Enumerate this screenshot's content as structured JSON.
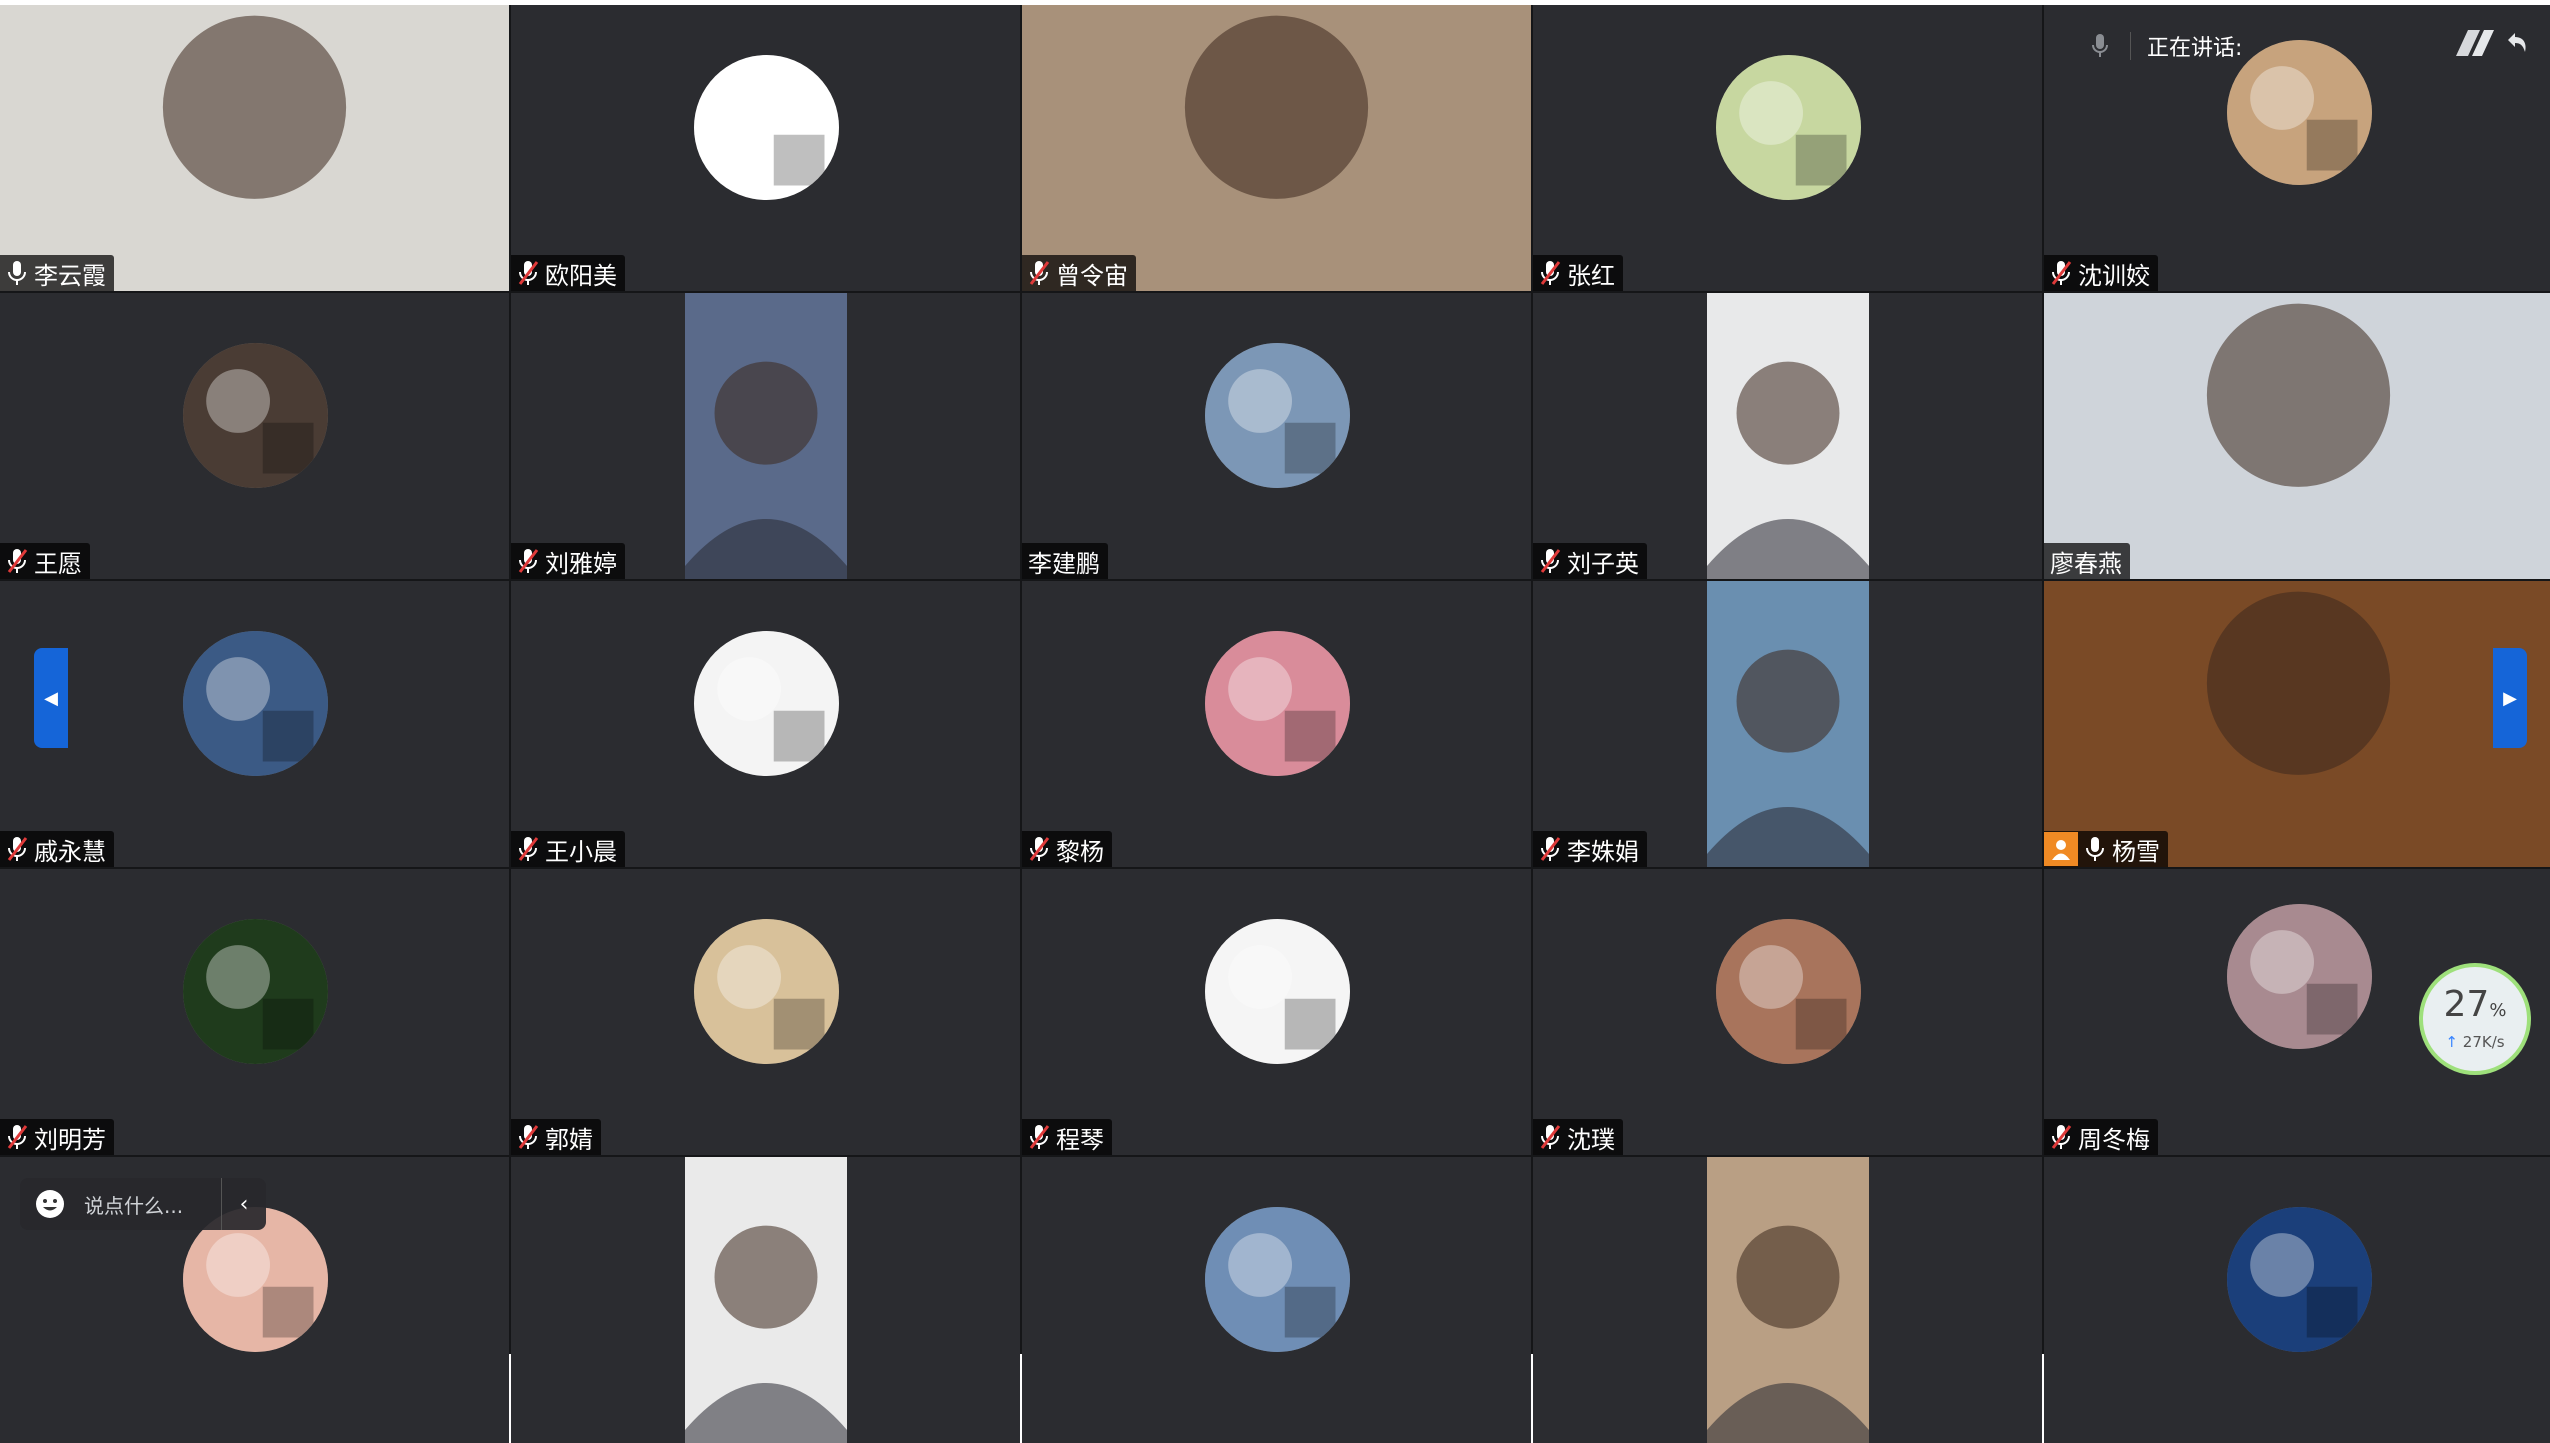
{
  "speaking_bar": {
    "label": "正在讲话:"
  },
  "chat": {
    "placeholder": "说点什么..."
  },
  "network": {
    "percent": "27",
    "percent_unit": "%",
    "speed": "27K/s"
  },
  "participants": [
    {
      "name": "李云霞",
      "mic": "on",
      "media": "video-full",
      "color": "#d9d7d2"
    },
    {
      "name": "欧阳美",
      "mic": "off",
      "media": "avatar",
      "color": "#ffffff"
    },
    {
      "name": "曾令宙",
      "mic": "off",
      "media": "video-full",
      "color": "#a8917a"
    },
    {
      "name": "张红",
      "mic": "off",
      "media": "avatar",
      "color": "#c7d7a0"
    },
    {
      "name": "沈训姣",
      "mic": "off",
      "media": "avatar-small",
      "color": "#c7a37d"
    },
    {
      "name": "王愿",
      "mic": "off",
      "media": "avatar",
      "color": "#4a3c34"
    },
    {
      "name": "刘雅婷",
      "mic": "off",
      "media": "video-portrait",
      "color": "#5a6a8a"
    },
    {
      "name": "李建鹏",
      "mic": "none",
      "media": "avatar",
      "color": "#7c97b6"
    },
    {
      "name": "刘子英",
      "mic": "off",
      "media": "video-portrait",
      "color": "#e8e9ea"
    },
    {
      "name": "廖春燕",
      "mic": "none",
      "media": "video-full",
      "color": "#cfd4da"
    },
    {
      "name": "戚永慧",
      "mic": "off",
      "media": "avatar",
      "color": "#3b5a85"
    },
    {
      "name": "王小晨",
      "mic": "off",
      "media": "avatar",
      "color": "#f4f4f4"
    },
    {
      "name": "黎杨",
      "mic": "off",
      "media": "avatar",
      "color": "#d98c9a"
    },
    {
      "name": "李姝娟",
      "mic": "off",
      "media": "video-portrait",
      "color": "#6a8fb0"
    },
    {
      "name": "杨雪",
      "mic": "on",
      "media": "video-full",
      "color": "#7a4a26",
      "host": true
    },
    {
      "name": "刘明芳",
      "mic": "off",
      "media": "avatar",
      "color": "#1f3b1c"
    },
    {
      "name": "郭婧",
      "mic": "off",
      "media": "avatar",
      "color": "#d8c19a"
    },
    {
      "name": "程琴",
      "mic": "off",
      "media": "avatar",
      "color": "#f5f5f5"
    },
    {
      "name": "沈璞",
      "mic": "off",
      "media": "avatar",
      "color": "#a8745c"
    },
    {
      "name": "周冬梅",
      "mic": "off",
      "media": "avatar-small",
      "color": "#a88a90"
    },
    {
      "name": "",
      "mic": "none",
      "media": "avatar",
      "color": "#e6b6a6"
    },
    {
      "name": "",
      "mic": "none",
      "media": "video-portrait",
      "color": "#eaeaea"
    },
    {
      "name": "",
      "mic": "none",
      "media": "avatar",
      "color": "#6f8eb5"
    },
    {
      "name": "",
      "mic": "none",
      "media": "video-portrait",
      "color": "#b99f84"
    },
    {
      "name": "",
      "mic": "none",
      "media": "avatar",
      "color": "#1b3f7a"
    }
  ]
}
